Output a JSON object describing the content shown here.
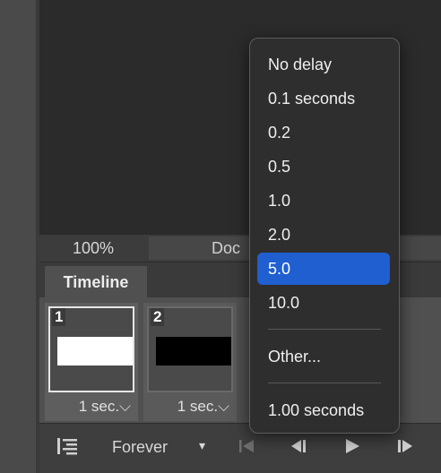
{
  "status": {
    "zoom": "100%",
    "doc_label": "Doc"
  },
  "timeline": {
    "tab_label": "Timeline",
    "frames": [
      {
        "number": "1",
        "delay": "1 sec.⌵",
        "thumb_color": "#ffffff",
        "selected": true
      },
      {
        "number": "2",
        "delay": "1 sec.⌵",
        "thumb_color": "#000000",
        "selected": false
      }
    ]
  },
  "toolbar": {
    "loop_label": "Forever",
    "loop_arrow": "▾",
    "convert_icon": "timeline-convert-icon",
    "first_frame_icon": "first-frame-icon",
    "prev_frame_icon": "previous-frame-icon",
    "play_icon": "play-icon",
    "next_frame_icon": "next-frame-icon"
  },
  "delay_menu": {
    "items": [
      {
        "label": "No delay"
      },
      {
        "label": "0.1 seconds"
      },
      {
        "label": "0.2"
      },
      {
        "label": "0.5"
      },
      {
        "label": "1.0"
      },
      {
        "label": "2.0"
      },
      {
        "label": "5.0",
        "highlighted": true
      },
      {
        "label": "10.0"
      },
      {
        "label": "Other..."
      },
      {
        "label": "1.00 seconds"
      }
    ],
    "highlight_color": "#1f5fd0"
  }
}
